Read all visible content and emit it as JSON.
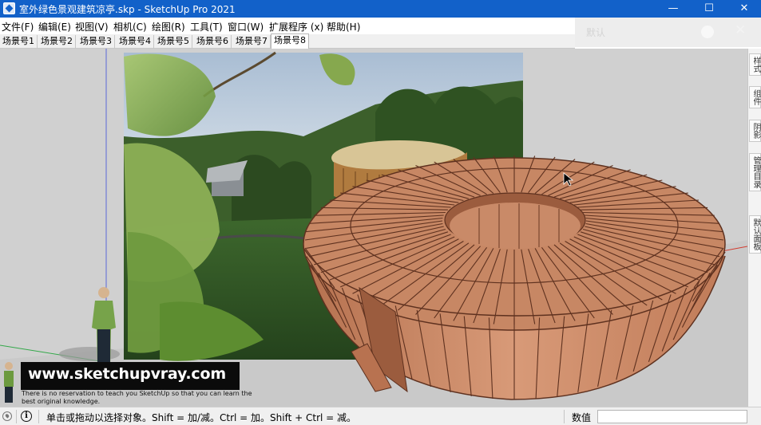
{
  "window": {
    "title": "室外绿色景观建筑凉亭.skp - SketchUp Pro 2021",
    "minimize_glyph": "—",
    "maximize_glyph": "☐",
    "close_glyph": "✕"
  },
  "menu": [
    "文件(F)",
    "编辑(E)",
    "视图(V)",
    "相机(C)",
    "绘图(R)",
    "工具(T)",
    "窗口(W)",
    "扩展程序 (x)",
    "帮助(H)"
  ],
  "ghost_toolbar": {
    "label": "默认",
    "close_glyph": "✕"
  },
  "scene_tabs": [
    "场景号1",
    "场景号2",
    "场景号3",
    "场景号4",
    "场景号5",
    "场景号6",
    "场景号7",
    "场景号8"
  ],
  "active_scene_index": 7,
  "right_trays": [
    "样式",
    "组件",
    "阴影",
    "管理目录",
    "默认面板"
  ],
  "watermark": {
    "url": "www.sketchupvray.com",
    "note": "There is no reservation to teach you SketchUp so that you can learn the best original knowledge."
  },
  "status": {
    "hint": "单击或拖动以选择对象。Shift = 加/减。Ctrl = 加。Shift + Ctrl = 减。",
    "measurements_label": "数值",
    "measurements_value": ""
  },
  "colors": {
    "titlebar": "#1261c9",
    "viewport_bg": "#d0d0d0",
    "wood": "#c98a68",
    "wood_dark": "#7a4530",
    "axis_red": "#d23b2f",
    "axis_green": "#34a84a",
    "axis_blue": "#5a67d8"
  }
}
